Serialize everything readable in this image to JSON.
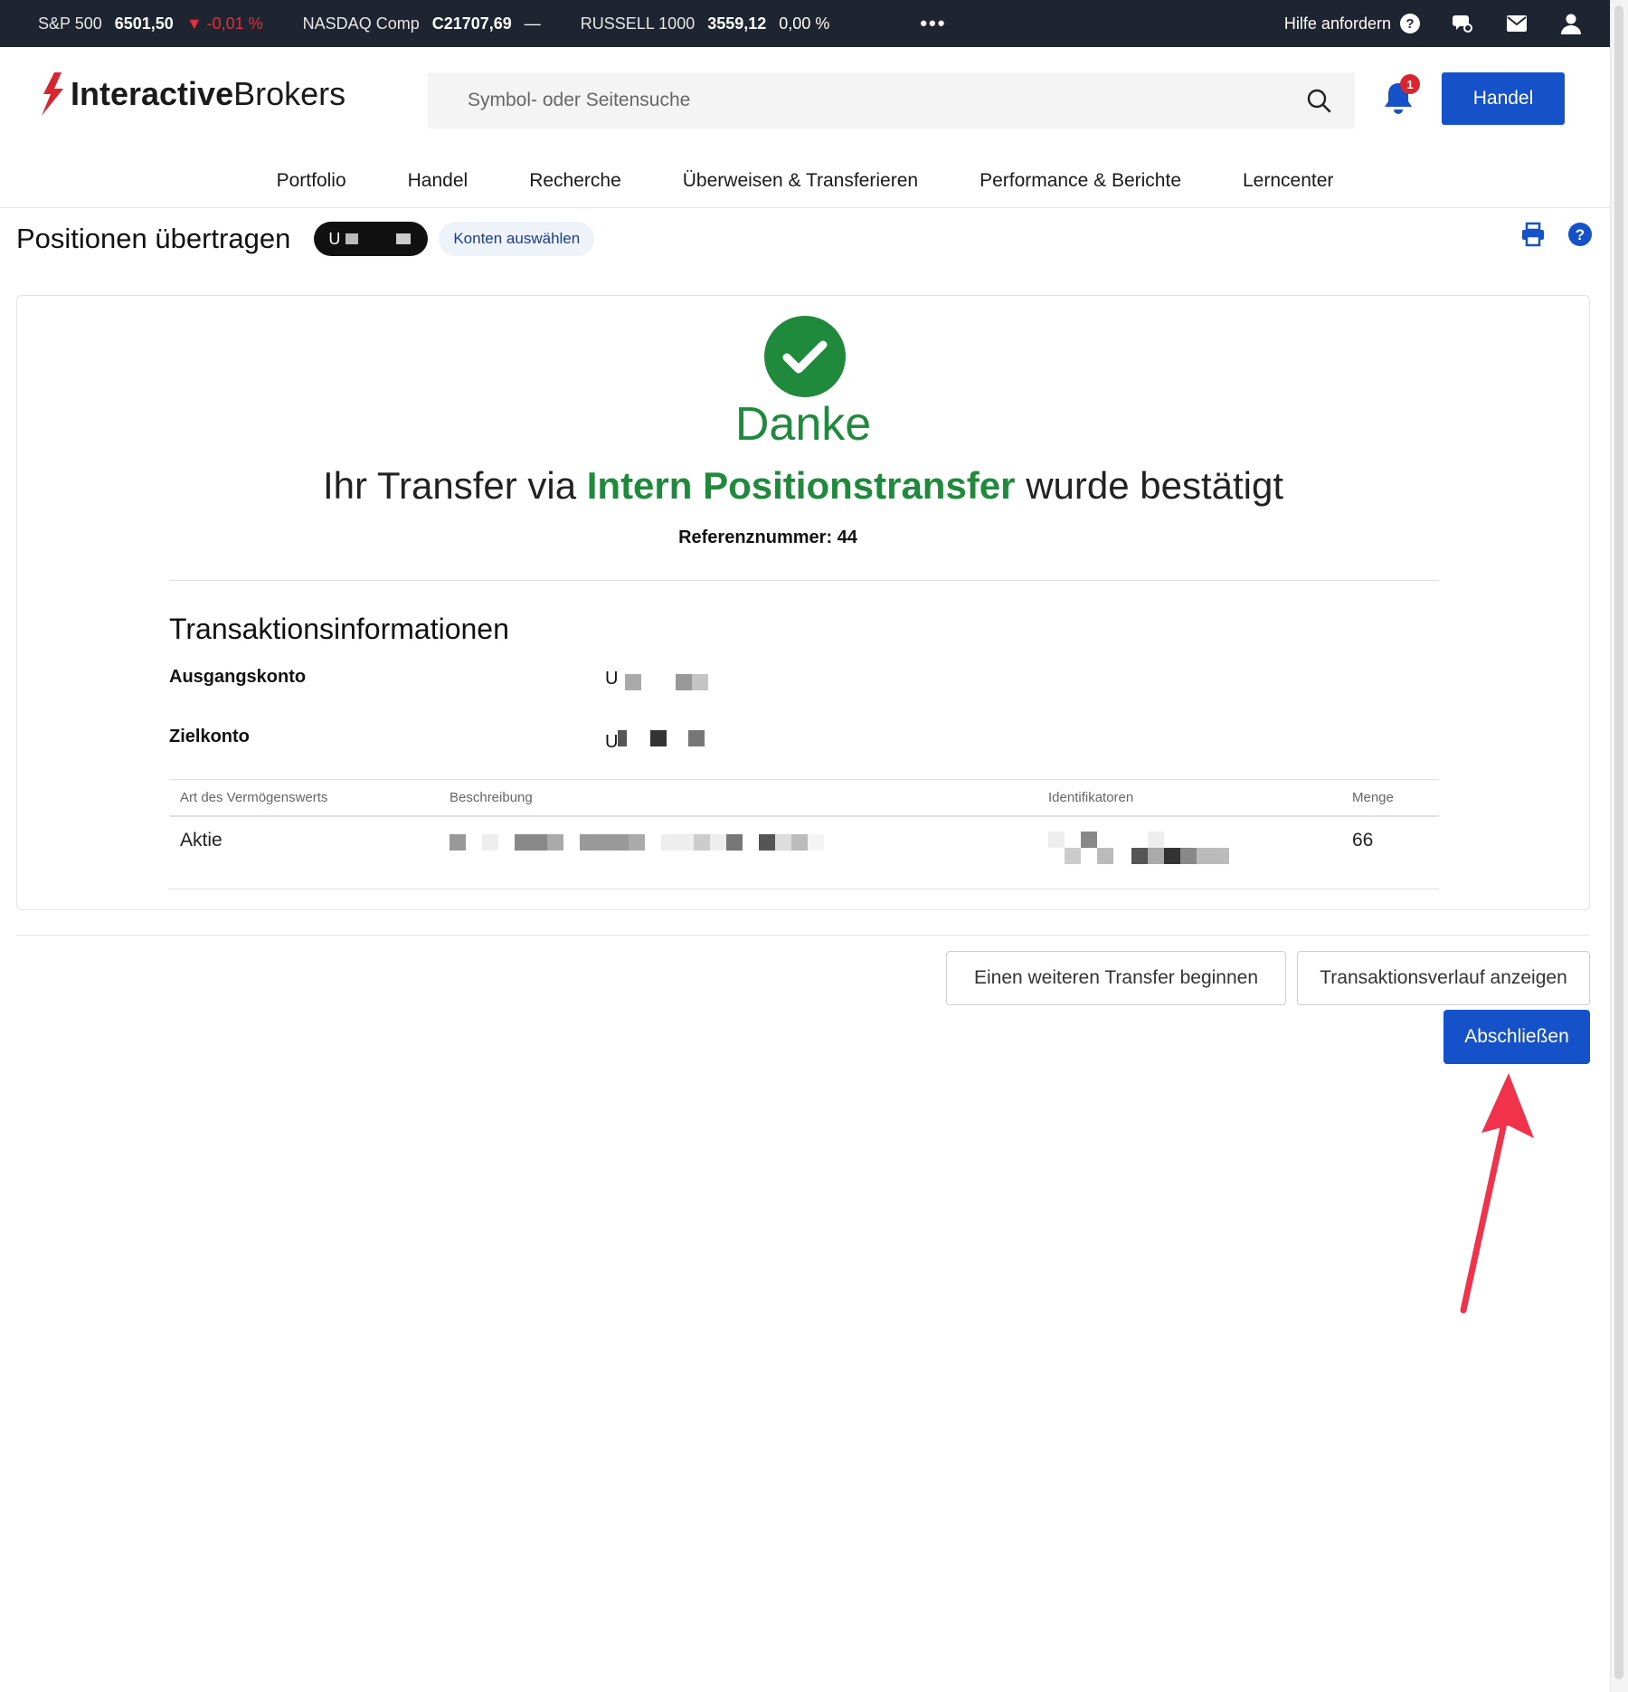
{
  "ticker": {
    "items": [
      {
        "name": "S&P 500",
        "value": "6501,50",
        "change": "▼ -0,01 %",
        "direction": "down"
      },
      {
        "name": "NASDAQ Comp",
        "value": "C21707,69",
        "change": "—",
        "direction": "flat"
      },
      {
        "name": "RUSSELL 1000",
        "value": "3559,12",
        "change": "0,00 %",
        "direction": "flat"
      }
    ],
    "more": "•••",
    "help_label": "Hilfe anfordern"
  },
  "header": {
    "logo_bold": "Interactive",
    "logo_light": "Brokers",
    "search_placeholder": "Symbol- oder Seitensuche",
    "notification_count": "1",
    "trade_button": "Handel"
  },
  "nav": {
    "items": [
      "Portfolio",
      "Handel",
      "Recherche",
      "Überweisen & Transferieren",
      "Performance & Berichte",
      "Lerncenter"
    ]
  },
  "page": {
    "title": "Positionen übertragen",
    "account_prefix": "U",
    "select_accounts": "Konten auswählen"
  },
  "confirmation": {
    "heading": "Danke",
    "text_before": "Ihr Transfer via",
    "method": "Intern Positionstransfer",
    "text_after": "wurde bestätigt",
    "reference": "Referenznummer: 44"
  },
  "transaction": {
    "section_title": "Transaktionsinformationen",
    "source_label": "Ausgangskonto",
    "source_prefix": "U",
    "target_label": "Zielkonto",
    "target_prefix": "U",
    "columns": [
      "Art des Vermögenswerts",
      "Beschreibung",
      "Identifikatoren",
      "Menge"
    ],
    "rows": [
      {
        "asset_type": "Aktie",
        "quantity": "66"
      }
    ]
  },
  "actions": {
    "another_transfer": "Einen weiteren Transfer beginnen",
    "history": "Transaktionsverlauf anzeigen",
    "finish": "Abschließen"
  },
  "colors": {
    "ticker_bg": "#1e2430",
    "primary": "#1551c8",
    "success": "#1f8a3c",
    "negative": "#e0303a",
    "annotation_arrow": "#f0334a"
  }
}
